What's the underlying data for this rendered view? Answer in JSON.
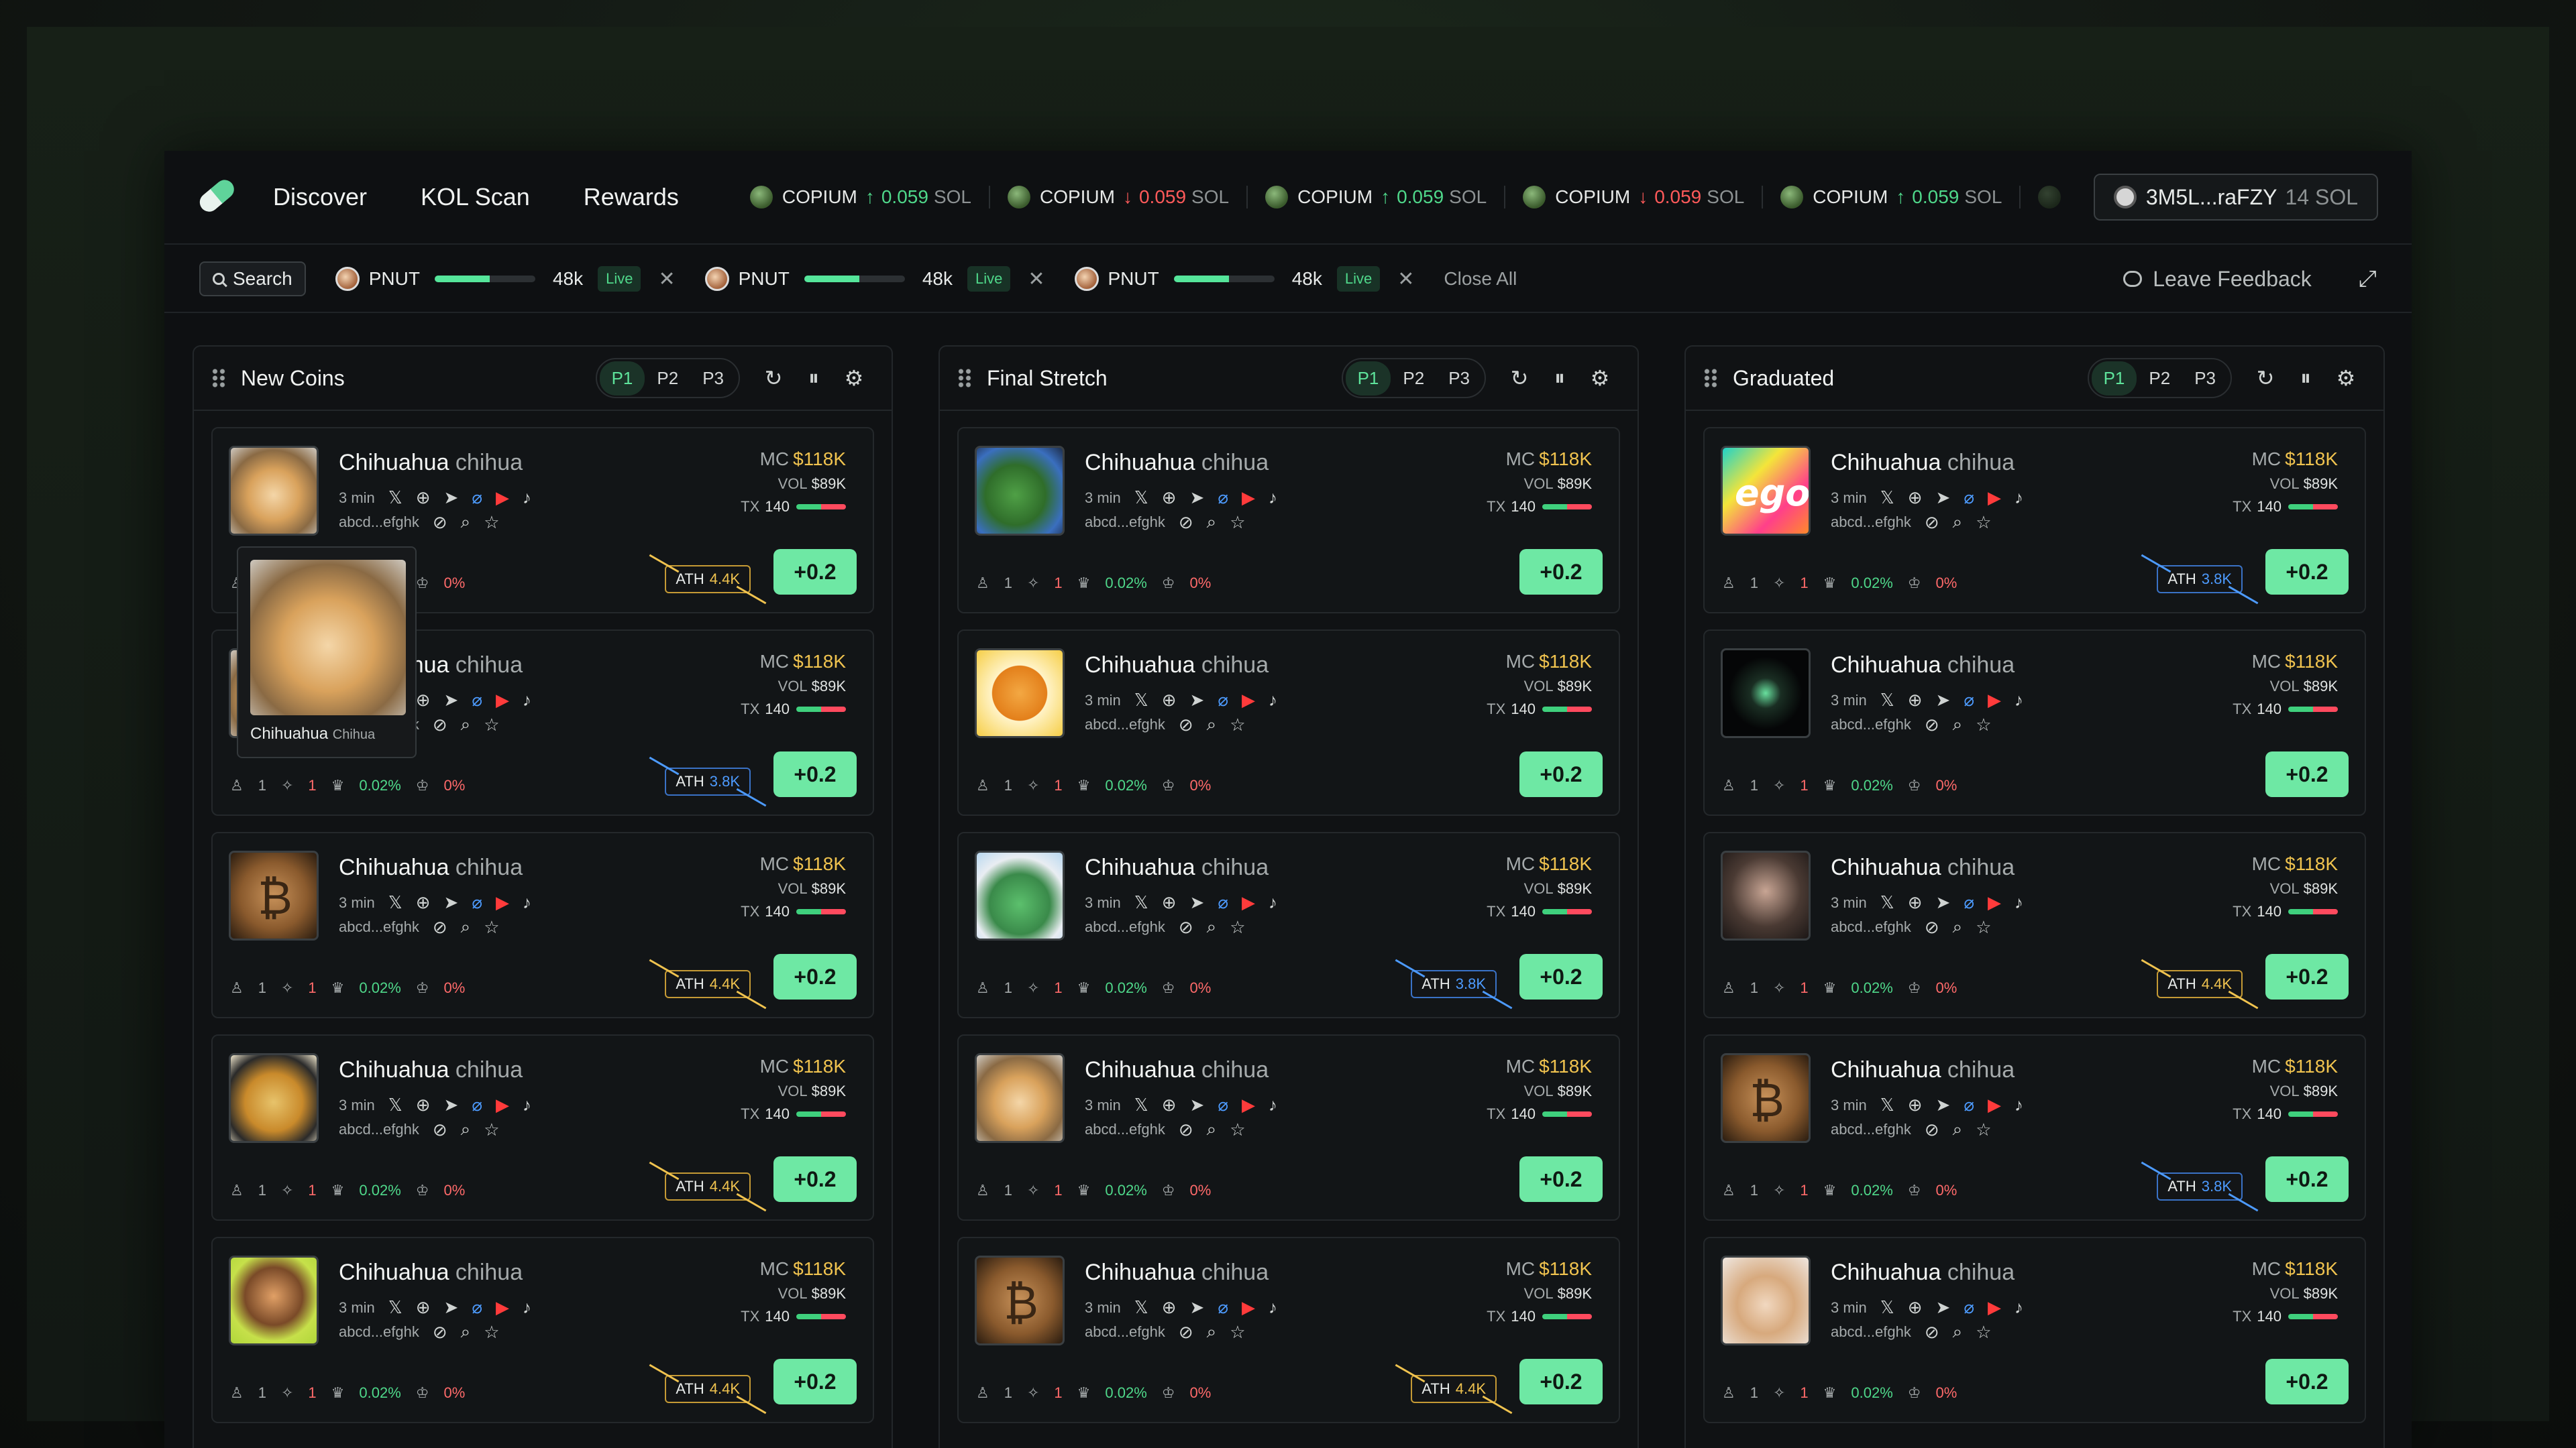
{
  "nav": {
    "links": [
      "Discover",
      "KOL Scan",
      "Rewards"
    ],
    "ticker": [
      {
        "name": "COPIUM",
        "dir": "up",
        "value": "0.059",
        "unit": "SOL"
      },
      {
        "name": "COPIUM",
        "dir": "down",
        "value": "0.059",
        "unit": "SOL"
      },
      {
        "name": "COPIUM",
        "dir": "up",
        "value": "0.059",
        "unit": "SOL"
      },
      {
        "name": "COPIUM",
        "dir": "down",
        "value": "0.059",
        "unit": "SOL"
      },
      {
        "name": "COPIUM",
        "dir": "up",
        "value": "0.059",
        "unit": "SOL"
      }
    ],
    "wallet": {
      "address": "3M5L...raFZY",
      "balance": "14 SOL"
    }
  },
  "subbar": {
    "search_label": "Search",
    "positions": [
      {
        "name": "PNUT",
        "value": "48k",
        "status": "Live",
        "progress": 0.55
      },
      {
        "name": "PNUT",
        "value": "48k",
        "status": "Live",
        "progress": 0.55
      },
      {
        "name": "PNUT",
        "value": "48k",
        "status": "Live",
        "progress": 0.55
      }
    ],
    "close_all": "Close All",
    "feedback": "Leave Feedback"
  },
  "columns": [
    {
      "title": "New Coins",
      "pages": [
        "P1",
        "P2",
        "P3"
      ],
      "active_page": "P1",
      "cards": [
        {
          "thumb": "dog",
          "ath": "4.4K",
          "ath_color": "gold"
        },
        {
          "thumb": "dog",
          "ath": "3.8K",
          "ath_color": "blue"
        },
        {
          "thumb": "btc",
          "ath": "4.4K",
          "ath_color": "gold"
        },
        {
          "thumb": "hat",
          "ath": "4.4K",
          "ath_color": "gold"
        },
        {
          "thumb": "monkey",
          "ath": "4.4K",
          "ath_color": "gold"
        }
      ]
    },
    {
      "title": "Final Stretch",
      "pages": [
        "P1",
        "P2",
        "P3"
      ],
      "active_page": "P1",
      "cards": [
        {
          "thumb": "pepe",
          "ath": "",
          "ath_color": ""
        },
        {
          "thumb": "shiba",
          "ath": "",
          "ath_color": ""
        },
        {
          "thumb": "bunny",
          "ath": "3.8K",
          "ath_color": "blue"
        },
        {
          "thumb": "dog",
          "ath": "",
          "ath_color": ""
        },
        {
          "thumb": "btc",
          "ath": "4.4K",
          "ath_color": "gold"
        }
      ]
    },
    {
      "title": "Graduated",
      "pages": [
        "P1",
        "P2",
        "P3"
      ],
      "active_page": "P1",
      "cards": [
        {
          "thumb": "ego",
          "ath": "3.8K",
          "ath_color": "blue"
        },
        {
          "thumb": "pill",
          "ath": "",
          "ath_color": ""
        },
        {
          "thumb": "face",
          "ath": "4.4K",
          "ath_color": "gold"
        },
        {
          "thumb": "btc",
          "ath": "3.8K",
          "ath_color": "blue"
        },
        {
          "thumb": "cat",
          "ath": "",
          "ath_color": ""
        }
      ]
    }
  ],
  "card_common": {
    "name": "Chihuahua",
    "ticker": "chihua",
    "age": "3 min",
    "address": "abcd...efghk",
    "mc_label": "MC",
    "mc_value": "$118K",
    "vol_label": "VOL",
    "vol_value": "$89K",
    "tx_label": "TX",
    "tx_value": "140",
    "holders": "1",
    "pro": "1",
    "top10": "0.02%",
    "dev": "0%",
    "ath_label": "ATH",
    "buy_label": "+0.2"
  },
  "popover": {
    "name": "Chihuahua",
    "ticker": "Chihua"
  },
  "colors": {
    "accent_green": "#6ee8a4",
    "price_up": "#4fd88a",
    "price_down": "#ff5a5a",
    "mc_gold": "#f0c34f",
    "link_blue": "#4d9bff"
  }
}
